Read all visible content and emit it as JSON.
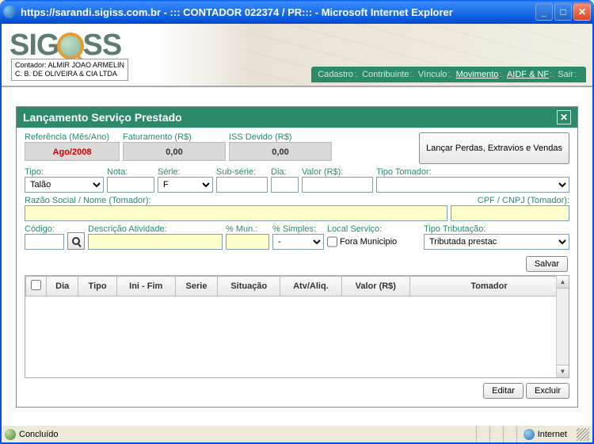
{
  "window": {
    "title": "https://sarandi.sigiss.com.br - ::: CONTADOR 022374 / PR::: - Microsoft Internet Explorer"
  },
  "contador": {
    "line1": "Contador: ALMIR JOAO ARMELIN",
    "line2": "C. B. DE OLIVEIRA & CIA LTDA"
  },
  "logo": {
    "s": "S",
    "i": "I",
    "g": "G",
    "ss": "SS"
  },
  "nav": {
    "cadastro": "Cadastro",
    "contribuinte": "Contribuinte",
    "vinculo": "Vínculo",
    "movimento": "Movimento",
    "aidf": "AIDF & NF",
    "sair": "Sair"
  },
  "panel": {
    "title": "Lançamento Serviço Prestado",
    "ref_label": "Referência (Mês/Ano)",
    "ref_value": "Ago/2008",
    "fat_label": "Faturamento (R$)",
    "fat_value": "0,00",
    "iss_label": "ISS Devido (R$)",
    "iss_value": "0,00",
    "lancar_perdas": "Lançar Perdas, Extravios e Vendas"
  },
  "fields": {
    "tipo_label": "Tipo:",
    "tipo_value": "Talão",
    "nota_label": "Nota:",
    "serie_label": "Série:",
    "serie_value": "F",
    "subserie_label": "Sub-série:",
    "dia_label": "Dia:",
    "valor_label": "Valor (R$):",
    "tipo_tomador_label": "Tipo Tomador:",
    "razao_label": "Razão Social / Nome (Tomador):",
    "cpf_label": "CPF / CNPJ (Tomador):",
    "codigo_label": "Código:",
    "desc_label": "Descrição Atividade:",
    "mun_label": "% Mun.:",
    "simples_label": "% Simples:",
    "simples_value": "-",
    "local_label": "Local Serviço:",
    "fora_municipio": "Fora Municipio",
    "tipo_trib_label": "Tipo Tributação:",
    "tipo_trib_value": "Tributada prestac"
  },
  "buttons": {
    "salvar": "Salvar",
    "editar": "Editar",
    "excluir": "Excluir"
  },
  "grid": {
    "headers": {
      "dia": "Dia",
      "tipo": "Tipo",
      "ini_fim": "Ini - Fim",
      "serie": "Serie",
      "situacao": "Situação",
      "atv_aliq": "Atv/Aliq.",
      "valor": "Valor (R$)",
      "tomador": "Tomador"
    }
  },
  "status": {
    "done": "Concluído",
    "zone": "Internet"
  }
}
